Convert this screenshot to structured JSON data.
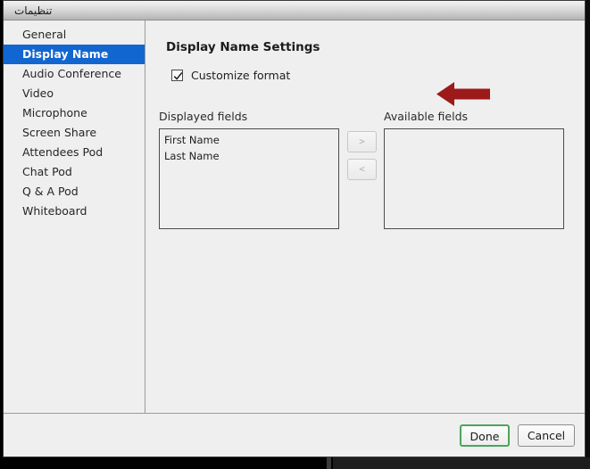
{
  "window": {
    "title": "تنظیمات",
    "title_direction": "rtl"
  },
  "sidebar": {
    "items": [
      {
        "label": "General",
        "selected": false
      },
      {
        "label": "Display Name",
        "selected": true
      },
      {
        "label": "Audio Conference",
        "selected": false
      },
      {
        "label": "Video",
        "selected": false
      },
      {
        "label": "Microphone",
        "selected": false
      },
      {
        "label": "Screen Share",
        "selected": false
      },
      {
        "label": "Attendees Pod",
        "selected": false
      },
      {
        "label": "Chat Pod",
        "selected": false
      },
      {
        "label": "Q & A Pod",
        "selected": false
      },
      {
        "label": "Whiteboard",
        "selected": false
      }
    ]
  },
  "main": {
    "panel_title": "Display Name Settings",
    "customize_format": {
      "label": "Customize format",
      "checked": true
    },
    "displayed_fields": {
      "label": "Displayed fields",
      "items": [
        "First Name",
        "Last Name"
      ]
    },
    "available_fields": {
      "label": "Available fields",
      "items": []
    },
    "transfer_buttons": {
      "move_right_label": ">",
      "move_left_label": "<",
      "enabled": false
    }
  },
  "annotation": {
    "arrow_direction": "left",
    "arrow_color": "#9c1a1a"
  },
  "footer": {
    "done_label": "Done",
    "cancel_label": "Cancel"
  },
  "colors": {
    "selection_blue": "#1266d0",
    "done_focus_green": "#4aa55c",
    "annotation_red": "#9c1a1a",
    "window_background": "#efefef"
  }
}
